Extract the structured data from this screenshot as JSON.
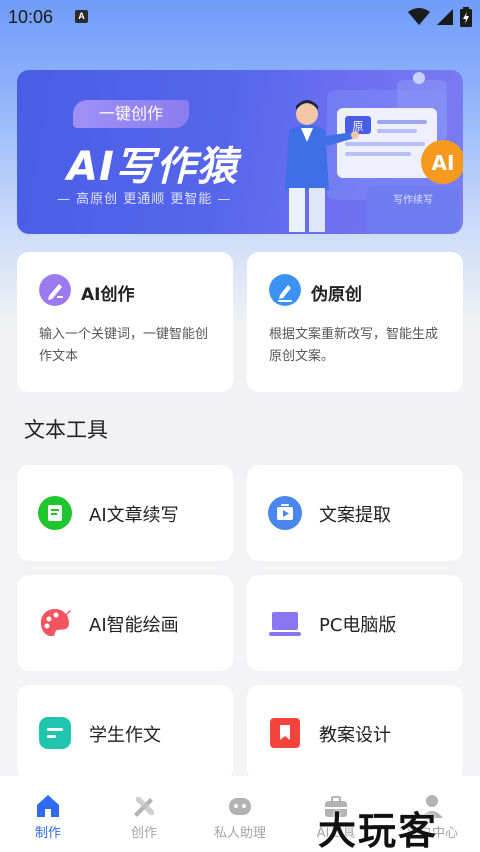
{
  "status_bar": {
    "time": "10:06",
    "notification_letter": "A"
  },
  "banner": {
    "tag": "一键创作",
    "title": "AI写作猿",
    "subtitle": "— 高原创 更通顺 更智能 —",
    "art_doc_label": "原",
    "art_badge": "AI",
    "art_card_text": "写作续写"
  },
  "features": [
    {
      "title": "AI创作",
      "desc": "输入一个关键词，一键智能创作文本",
      "color": "#9b7af0"
    },
    {
      "title": "伪原创",
      "desc": "根据文案重新改写，智能生成原创文案。",
      "color": "#3b92f2"
    }
  ],
  "section_title": "文本工具",
  "tools": [
    {
      "label": "AI文章续写",
      "icon": "document-continue-icon",
      "color": "#1ec62d"
    },
    {
      "label": "文案提取",
      "icon": "video-extract-icon",
      "color": "#4a86ec"
    },
    {
      "label": "AI智能绘画",
      "icon": "palette-icon",
      "color": "#f2555f"
    },
    {
      "label": "PC电脑版",
      "icon": "laptop-icon",
      "color": "#8b76f2"
    },
    {
      "label": "学生作文",
      "icon": "essay-icon",
      "color": "#1fc5ad"
    },
    {
      "label": "教案设计",
      "icon": "bookmark-icon",
      "color": "#f3433d"
    }
  ],
  "nav": [
    {
      "label": "制作",
      "active": true
    },
    {
      "label": "创作",
      "active": false
    },
    {
      "label": "私人助理",
      "active": false
    },
    {
      "label": "AI工具",
      "active": false
    },
    {
      "label": "用户中心",
      "active": false
    }
  ],
  "watermark": "大玩客",
  "colors": {
    "accent": "#2f6cf0",
    "banner": "#5566ec"
  }
}
